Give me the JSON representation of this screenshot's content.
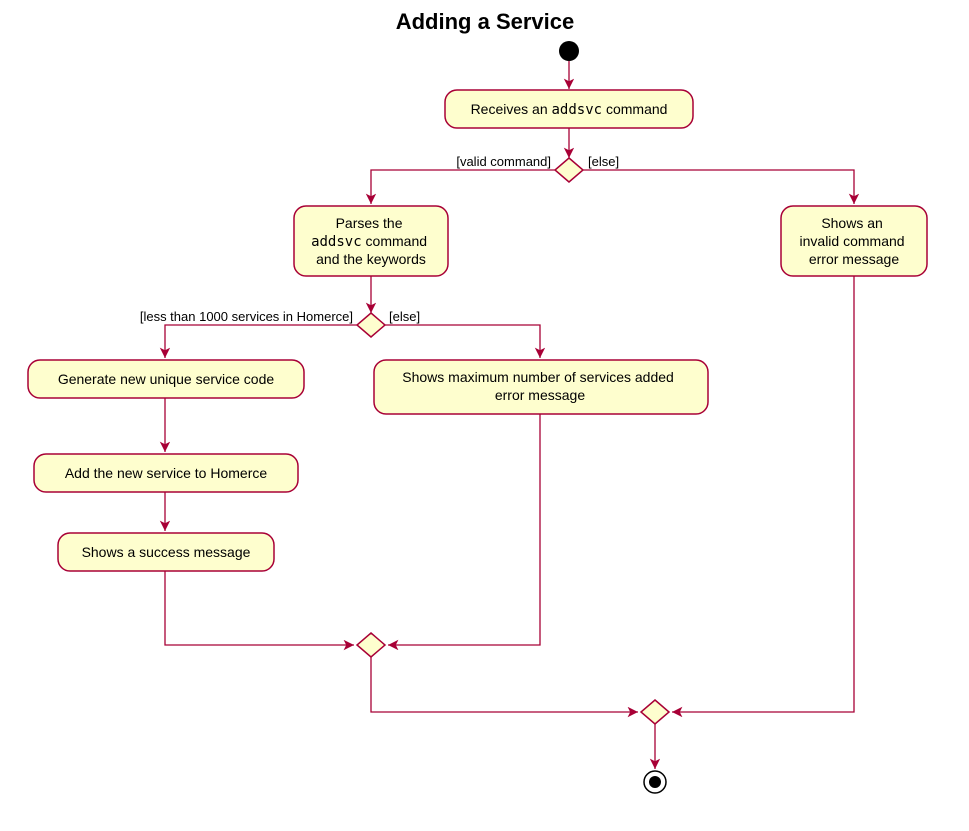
{
  "title": "Adding a Service",
  "nodes": {
    "receives": {
      "text_pre": "Receives an ",
      "text_code": "addsvc",
      "text_post": " command"
    },
    "parses": {
      "line1_pre": "Parses the",
      "line2_code": "addsvc",
      "line2_post": " command",
      "line3": "and the keywords"
    },
    "invalid": {
      "line1": "Shows an",
      "line2": "invalid command",
      "line3": "error message"
    },
    "generate": "Generate new unique service code",
    "max_error": {
      "line1": "Shows maximum number of services added",
      "line2": "error message"
    },
    "add_service": "Add the new service to Homerce",
    "success": "Shows a success message"
  },
  "guards": {
    "valid_command": "[valid command]",
    "else1": "[else]",
    "less_than": "[less than 1000 services in Homerce]",
    "else2": "[else]"
  }
}
